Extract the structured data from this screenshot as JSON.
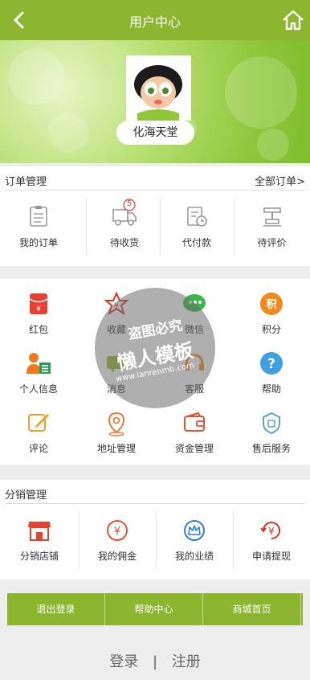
{
  "header": {
    "title": "用户中心"
  },
  "profile": {
    "username": "化海天堂"
  },
  "orders": {
    "title": "订单管理",
    "all_label": "全部订单>",
    "items": [
      {
        "label": "我的订单",
        "icon": "clipboard-icon"
      },
      {
        "label": "待收货",
        "icon": "delivery-truck-icon",
        "badge": "5"
      },
      {
        "label": "代付款",
        "icon": "invoice-clock-icon"
      },
      {
        "label": "待评价",
        "icon": "review-stamp-icon"
      }
    ]
  },
  "grid": {
    "items": [
      {
        "label": "红包",
        "icon": "red-envelope-icon",
        "color": "#e8412f"
      },
      {
        "label": "收藏",
        "icon": "star-badge-icon",
        "color": "#d9332b"
      },
      {
        "label": "微信",
        "icon": "wechat-icon",
        "color": "#39b54a"
      },
      {
        "label": "积分",
        "icon": "points-icon",
        "color": "#f28a1b"
      },
      {
        "label": "个人信息",
        "icon": "personal-info-icon",
        "color": "#f07a1a"
      },
      {
        "label": "消息",
        "icon": "message-icon",
        "color": "#8fbf2a"
      },
      {
        "label": "客服",
        "icon": "customer-service-icon",
        "color": "#f08a1b"
      },
      {
        "label": "帮助",
        "icon": "help-icon",
        "color": "#3ea0e4"
      },
      {
        "label": "评论",
        "icon": "comment-edit-icon",
        "color": "#f0a125"
      },
      {
        "label": "地址管理",
        "icon": "location-pin-icon",
        "color": "#f07a3a"
      },
      {
        "label": "资金管理",
        "icon": "wallet-icon",
        "color": "#e8522c"
      },
      {
        "label": "售后服务",
        "icon": "after-sales-shield-icon",
        "color": "#5aa3d8"
      }
    ]
  },
  "distribution": {
    "title": "分销管理",
    "items": [
      {
        "label": "分销店铺",
        "icon": "shop-icon",
        "color": "#e8412f"
      },
      {
        "label": "我的佣金",
        "icon": "yen-circle-icon",
        "color": "#e8522c"
      },
      {
        "label": "我的业绩",
        "icon": "crown-circle-icon",
        "color": "#2f7fd8"
      },
      {
        "label": "申请提现",
        "icon": "withdraw-yen-icon",
        "color": "#d9332b"
      }
    ]
  },
  "buttons": {
    "logout": "退出登录",
    "help": "帮助中心",
    "home": "商城首页"
  },
  "auth": {
    "login": "登录",
    "divider": "|",
    "register": "注册"
  },
  "watermark": {
    "line1": "盗图必究",
    "line2": "懒人模板",
    "line3": "www.lanrenmb.com"
  },
  "colors": {
    "brand": "#8db52f",
    "background": "#eeeeee"
  }
}
